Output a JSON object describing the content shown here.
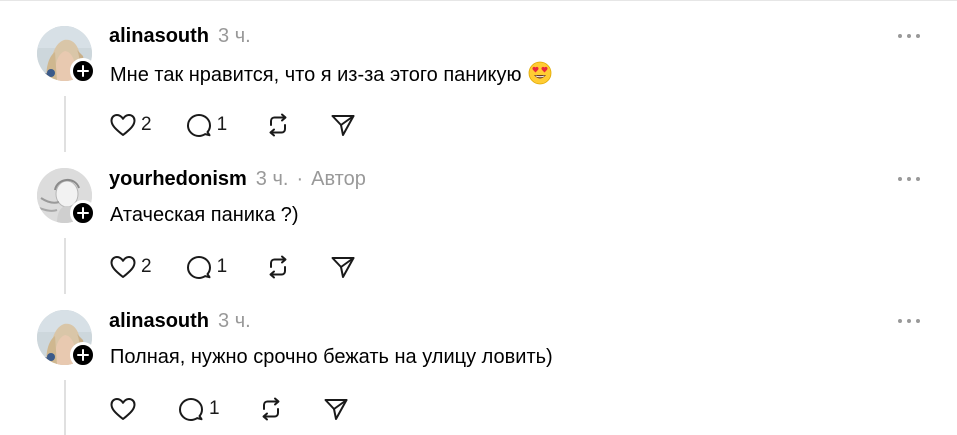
{
  "comments": [
    {
      "username": "alinasouth",
      "time": "3 ч.",
      "author_label": "",
      "text": "Мне так нравится, что я из-за этого паникую",
      "emoji": "heart-eyes-emoji",
      "likes": "2",
      "replies": "1"
    },
    {
      "username": "yourhedonism",
      "time": "3 ч.",
      "separator": "·",
      "author_label": "Автор",
      "text": "Атаческая паника ?)",
      "likes": "2",
      "replies": "1"
    },
    {
      "username": "alinasouth",
      "time": "3 ч.",
      "author_label": "",
      "text": "Полная, нужно срочно бежать на улицу ловить)",
      "likes": "",
      "replies": "1"
    }
  ],
  "icons": {
    "like": "heart-icon",
    "reply": "comment-bubble-icon",
    "repost": "repost-icon",
    "share": "send-icon",
    "more": "more-options-icon",
    "follow": "plus-icon"
  },
  "colors": {
    "muted": "#999999",
    "thread_line": "#e0e0e0",
    "badge": "#000000"
  }
}
